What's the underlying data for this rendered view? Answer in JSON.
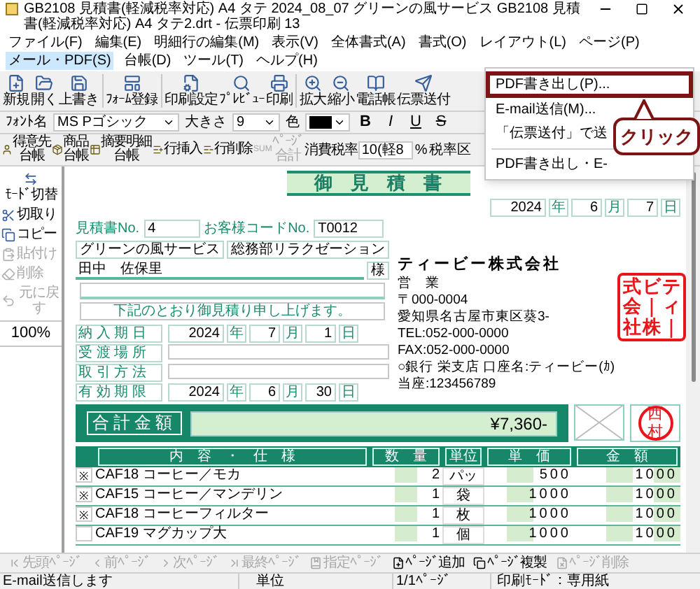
{
  "window": {
    "title": "GB2108 見積書(軽減税率対応) A4 タテ 2024_08_07 グリーンの風サービス GB2108 見積書(軽減税率対応) A4 タテ2.drt - 伝票印刷 13"
  },
  "menu": [
    {
      "label": "ファイル(F)",
      "selected": false
    },
    {
      "label": "編集(E)",
      "selected": false
    },
    {
      "label": "明細行の編集(M)",
      "selected": false
    },
    {
      "label": "表示(V)",
      "selected": false
    },
    {
      "label": "全体書式(A)",
      "selected": false
    },
    {
      "label": "書式(O)",
      "selected": false
    },
    {
      "label": "レイアウト(L)",
      "selected": false
    },
    {
      "label": "ページ(P)",
      "selected": false
    },
    {
      "label": "メール・PDF(S)",
      "selected": true
    },
    {
      "label": "台帳(D)",
      "selected": false
    },
    {
      "label": "ツール(T)",
      "selected": false
    },
    {
      "label": "ヘルプ(H)",
      "selected": false
    }
  ],
  "toolbar": [
    {
      "label": "新規"
    },
    {
      "label": "開く"
    },
    {
      "label": "上書き"
    },
    {
      "label": "ﾌｫｰﾑ登録"
    },
    {
      "label": "印刷設定"
    },
    {
      "label": "ﾌﾟﾚﾋﾞｭｰ"
    },
    {
      "label": "印刷"
    },
    {
      "label": "拡大"
    },
    {
      "label": "縮小"
    },
    {
      "label": "電話帳"
    },
    {
      "label": "伝票送付"
    }
  ],
  "font_bar": {
    "font_label": "ﾌｫﾝﾄ名",
    "font": "MS Pゴシック",
    "size_label": "大きさ",
    "size": "9",
    "color_label": "色",
    "color": "#000000",
    "styles": [
      {
        "kind": "bold",
        "label": "B"
      },
      {
        "kind": "italic",
        "label": "I"
      },
      {
        "kind": "underline",
        "label": "U"
      },
      {
        "kind": "strike",
        "label": "S"
      }
    ]
  },
  "ledger_bar": {
    "items": [
      {
        "lines": [
          "得意先",
          "台帳"
        ],
        "disabled": false
      },
      {
        "lines": [
          "商品",
          "台帳"
        ],
        "disabled": false
      },
      {
        "lines": [
          "摘要明細",
          "台帳"
        ],
        "disabled": false
      },
      {
        "lines": [
          "行挿入"
        ],
        "disabled": false
      },
      {
        "lines": [
          "行削除"
        ],
        "disabled": false
      },
      {
        "icon_text": "SUM",
        "lines": [
          "ﾍﾟｰｼﾞ",
          "合計"
        ],
        "disabled": true
      }
    ],
    "tax_label": "消費税率",
    "tax_value": "10(軽8",
    "percent": "%",
    "tax_class_label": "税率区"
  },
  "side_panel": {
    "items": [
      {
        "label": "ﾓｰﾄﾞ切替",
        "disabled": false
      },
      {
        "label": "切取り",
        "disabled": false
      },
      {
        "label": "コピー",
        "disabled": false
      },
      {
        "label": "貼付け",
        "disabled": true
      },
      {
        "label": "削除",
        "disabled": true
      },
      {
        "label": "元に戻す",
        "disabled": true
      }
    ],
    "zoom": "100%"
  },
  "dropdown": {
    "items": [
      {
        "label": "PDF書き出し(P)...",
        "selected": true
      },
      {
        "label": "E-mail送信(M)...",
        "selected": false
      },
      {
        "label": "「伝票送付」で送",
        "selected": false
      },
      {
        "label": "PDF書き出し・E-",
        "selected": false
      }
    ]
  },
  "callout": {
    "text": "クリック"
  },
  "document": {
    "title": "御　見　積　書",
    "date": [
      {
        "value": "2024",
        "unit": "年"
      },
      {
        "value": "6",
        "unit": "月"
      },
      {
        "value": "7",
        "unit": "日"
      }
    ],
    "estimate_no": {
      "label": "見積書No.",
      "value": "4"
    },
    "customer_code": {
      "label": "お客様コードNo.",
      "value": "T0012"
    },
    "customer_company": "グリーンの風サービス",
    "customer_department": "総務部リラクゼーション",
    "customer_name": "田中　佐保里",
    "honorific": "様",
    "greeting": "下記のとおり御見積り申し上げます。",
    "terms": [
      {
        "label": "納 入 期 日",
        "date": [
          {
            "value": "2024",
            "unit": "年"
          },
          {
            "value": "7",
            "unit": "月"
          },
          {
            "value": "1",
            "unit": "日"
          }
        ]
      },
      {
        "label": "受 渡 場 所"
      },
      {
        "label": "取 引 方 法"
      },
      {
        "label": "有 効 期 限",
        "date": [
          {
            "value": "2024",
            "unit": "年"
          },
          {
            "value": "6",
            "unit": "月"
          },
          {
            "value": "30",
            "unit": "日"
          }
        ]
      }
    ],
    "company": {
      "name": "ティービー株式会社",
      "department": "営　業",
      "postal": "〒000-0004",
      "address": "愛知県名古屋市東区葵3-",
      "tel": "TEL:052-000-0000",
      "fax": "FAX:052-000-0000",
      "bank": "○銀行 栄支店 口座名:ティービー(ｶ)",
      "account": "当座:123456789"
    },
    "company_seal": {
      "columns": [
        "式会社",
        "ビ｜株",
        "ティ｜"
      ]
    },
    "total": {
      "label": "合計金額",
      "value": "¥7,360-"
    },
    "personal_seal": {
      "text": "西村"
    },
    "table": {
      "columns": [
        "内　容　・　仕　様",
        "数　量",
        "単位",
        "単　価",
        "金　額"
      ],
      "rows": [
        {
          "mark": "※",
          "name": "CAF18 コーヒー／モカ",
          "quantity": "2",
          "unit": "パッ",
          "price": "500",
          "amount": "1000"
        },
        {
          "mark": "※",
          "name": "CAF15 コーヒー／マンデリン",
          "quantity": "1",
          "unit": "袋",
          "price": "1000",
          "amount": "1000"
        },
        {
          "mark": "※",
          "name": "CAF18 コーヒーフィルター",
          "quantity": "1",
          "unit": "枚",
          "price": "1000",
          "amount": "1000"
        },
        {
          "name": "CAF19 マグカップ大",
          "quantity": "1",
          "unit": "個",
          "price": "1000",
          "amount": "1000"
        }
      ]
    }
  },
  "page_bar": [
    {
      "label": "先頭ﾍﾟｰｼﾞ",
      "disabled": true
    },
    {
      "label": "前ﾍﾟｰｼﾞ",
      "disabled": true
    },
    {
      "label": "次ﾍﾟｰｼﾞ",
      "disabled": true
    },
    {
      "label": "最終ﾍﾟｰｼﾞ",
      "disabled": true
    },
    {
      "label": "指定ﾍﾟｰｼﾞ",
      "disabled": true
    },
    {
      "label": "ﾍﾟｰｼﾞ追加",
      "disabled": false
    },
    {
      "label": "ﾍﾟｰｼﾞ複製",
      "disabled": false
    },
    {
      "label": "ﾍﾟｰｼﾞ削除",
      "disabled": true
    }
  ],
  "status_bar": {
    "message": "E-mail送信します",
    "unit": "単位",
    "page": "1/1ﾍﾟｰｼﾞ",
    "mode": "印刷ﾓｰﾄﾞ：専用紙"
  }
}
